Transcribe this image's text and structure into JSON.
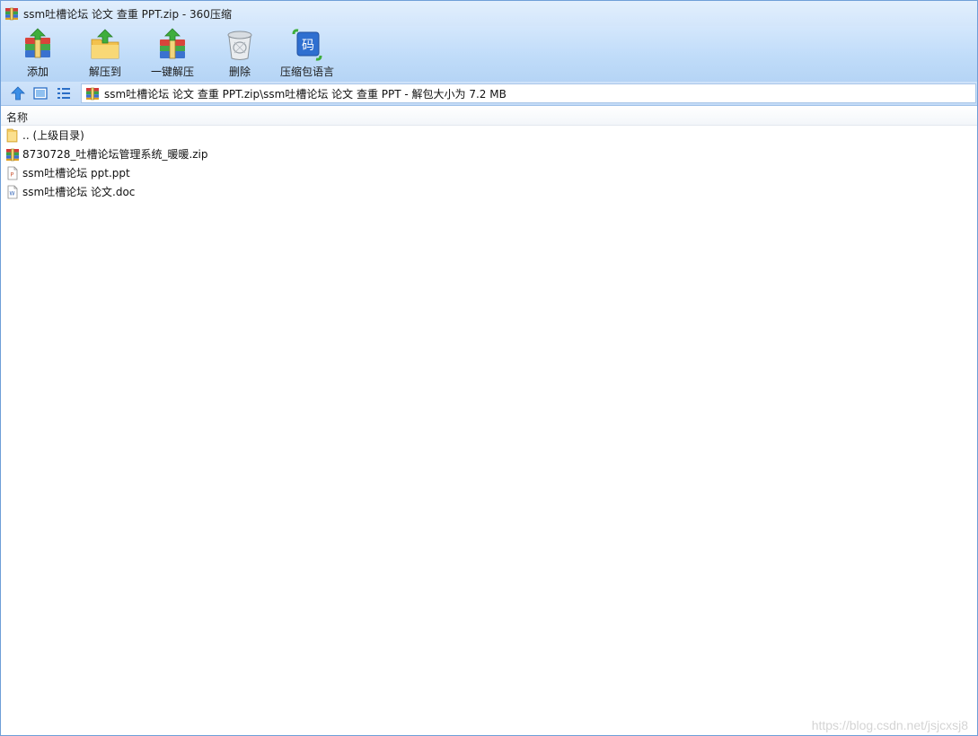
{
  "window": {
    "title": "ssm吐槽论坛  论文 查重 PPT.zip - 360压缩",
    "title_icon": "archive-icon"
  },
  "toolbar": {
    "buttons": [
      {
        "label": "添加",
        "icon": "add-archive-icon"
      },
      {
        "label": "解压到",
        "icon": "extract-to-folder-icon"
      },
      {
        "label": "一键解压",
        "icon": "one-click-extract-icon"
      },
      {
        "label": "删除",
        "icon": "delete-trash-icon"
      },
      {
        "label": "压缩包语言",
        "icon": "archive-language-icon"
      }
    ],
    "language_icon_glyph": "码"
  },
  "navbar": {
    "up_icon": "up-arrow-icon",
    "thumbnail_view_icon": "thumbnail-view-icon",
    "list_view_icon": "list-view-icon",
    "address": "ssm吐槽论坛  论文 查重 PPT.zip\\ssm吐槽论坛  论文 查重 PPT - 解包大小为 7.2 MB"
  },
  "list": {
    "column_name": "名称",
    "rows": [
      {
        "name": ".. (上级目录)",
        "icon": "folder-icon"
      },
      {
        "name": "8730728_吐槽论坛管理系统_暖暖.zip",
        "icon": "zip-archive-icon"
      },
      {
        "name": "ssm吐槽论坛 ppt.ppt",
        "icon": "ppt-file-icon"
      },
      {
        "name": "ssm吐槽论坛 论文.doc",
        "icon": "doc-file-icon"
      }
    ]
  },
  "watermark": "https://blog.csdn.net/jsjcxsj8",
  "colors": {
    "titlebar": "#d3e6fb",
    "toolbar": "#c0dcf9",
    "window_border": "#6f9fd8",
    "background": "#ffffff"
  }
}
